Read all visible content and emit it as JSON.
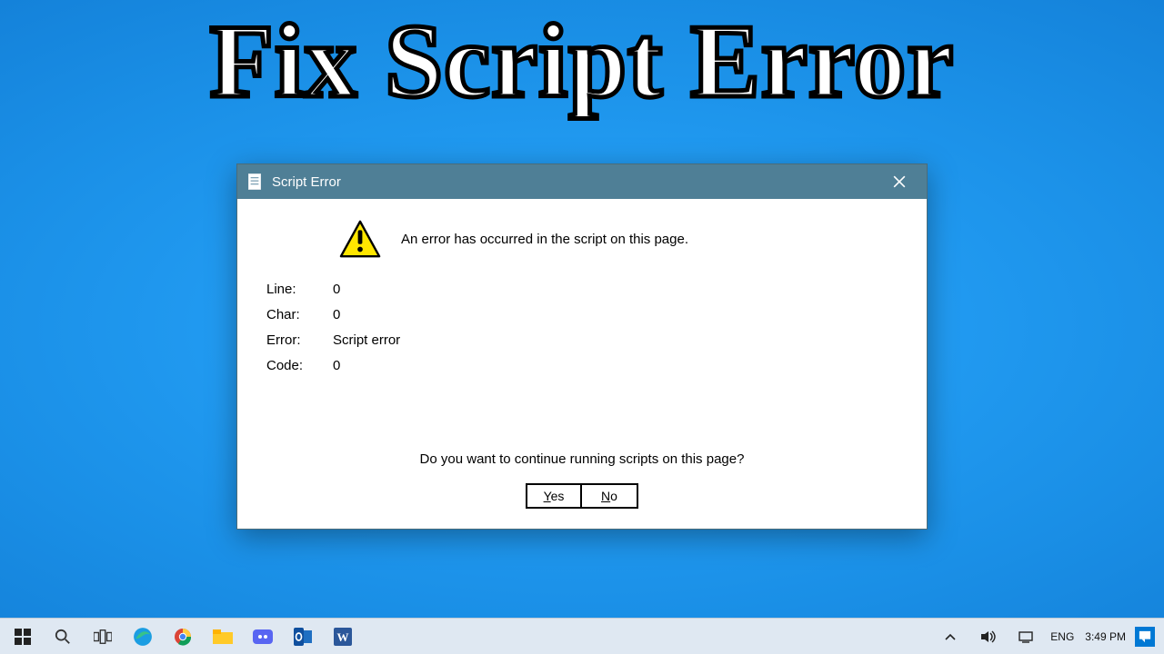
{
  "headline": "Fix Script Error",
  "dialog": {
    "title": "Script Error",
    "message": "An error has occurred in the script on this page.",
    "details": {
      "line_label": "Line:",
      "line_value": "0",
      "char_label": "Char:",
      "char_value": "0",
      "error_label": "Error:",
      "error_value": "Script error",
      "code_label": "Code:",
      "code_value": "0"
    },
    "prompt": "Do you want to continue running scripts on this page?",
    "yes_rest": "es",
    "no_rest": "o"
  },
  "taskbar": {
    "lang": "ENG",
    "time": "3:49 PM"
  }
}
